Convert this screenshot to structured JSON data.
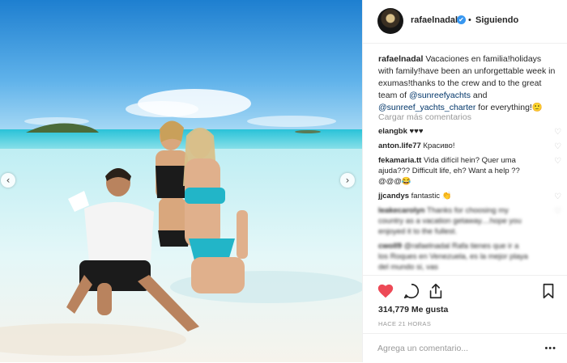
{
  "post": {
    "username": "rafaelnadal",
    "verified_glyph": "✔",
    "separator": "•",
    "follow_status": "Siguiendo",
    "caption_parts": {
      "user": "rafaelnadal",
      "text1": " Vacaciones en familia!holidays with family!have been an unforgettable week in exumas!thanks to the crew and to the great team of ",
      "mention1": "@sunreefyachts",
      "text2": " and ",
      "mention2": "@sunreef_yachts_charter",
      "text3": " for everything!🙂"
    },
    "load_more": "Cargar más comentarios",
    "likes": "314,779 Me gusta",
    "timestamp": "HACE 21 HORAS",
    "comment_placeholder": "Agrega un comentario...",
    "more_options": "•••"
  },
  "comments": [
    {
      "user": "elangbk",
      "text": " ♥♥♥",
      "blurred": false
    },
    {
      "user": "anton.life77",
      "text": " Красиво!",
      "blurred": false
    },
    {
      "user": "fekamaria.tt",
      "text": " Vida difícil hein? Quer uma ajuda??? Difficult life, eh? Want a help ??@@@😂",
      "blurred": false
    },
    {
      "user": "jjcandys",
      "text": " fantastic 👏",
      "blurred": false
    },
    {
      "user": "leakecarolyn",
      "text": " Thanks for choosing my country as a vacation getaway....hope you enjoyed it to the fullest.",
      "blurred": true
    },
    {
      "user": "cwoll9",
      "text": " @rafaelnadal Rafa tienes que ir a los Roques en Venezuela, es la mejor playa del mundo si, vas",
      "blurred": true
    }
  ],
  "icons": {
    "heart_comment": "♡",
    "prev_arrow": "‹",
    "next_arrow": "›"
  },
  "colors": {
    "like_red": "#ed4956",
    "mention_blue": "#003569",
    "verified_blue": "#3897f0",
    "muted_gray": "#999999"
  }
}
